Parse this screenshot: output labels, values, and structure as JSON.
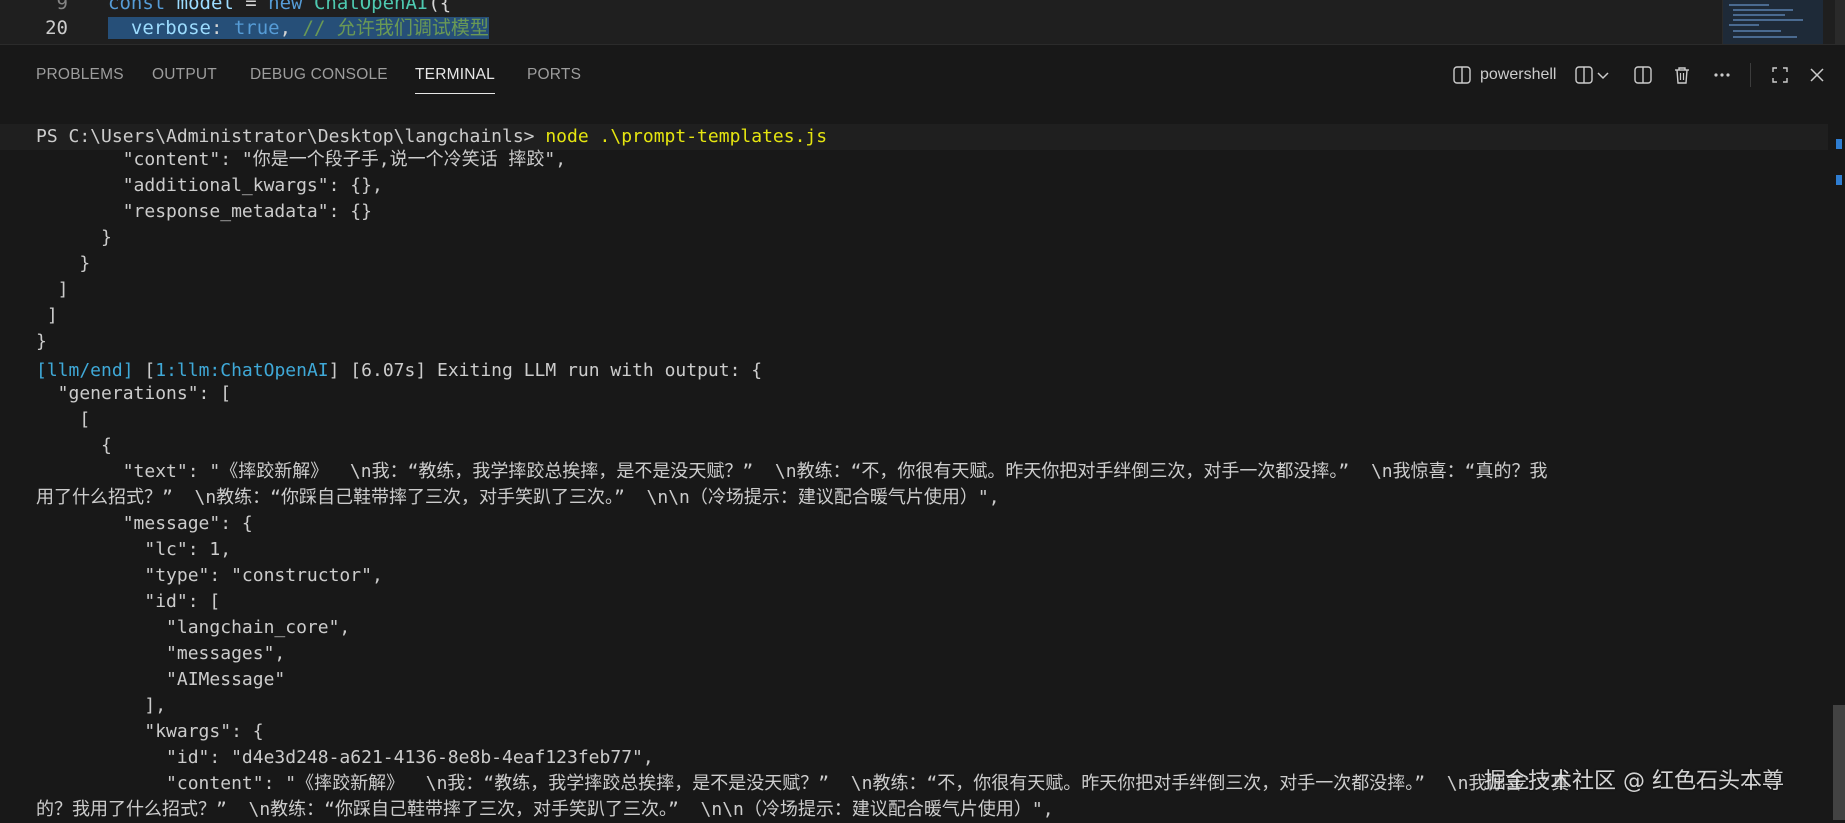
{
  "editor": {
    "lines": [
      {
        "number": "9",
        "parts": [
          {
            "cls": "kw",
            "text": "const "
          },
          {
            "cls": "prop",
            "text": "model"
          },
          {
            "cls": "plain",
            "text": " = "
          },
          {
            "cls": "kw",
            "text": "new "
          },
          {
            "cls": "fn",
            "text": "ChatOpenAI"
          },
          {
            "cls": "plain",
            "text": "({"
          }
        ]
      },
      {
        "number": "20",
        "parts": [
          {
            "cls": "prop",
            "text": "  verbose"
          },
          {
            "cls": "plain",
            "text": ": "
          },
          {
            "cls": "kw",
            "text": "true"
          },
          {
            "cls": "plain",
            "text": ", "
          },
          {
            "cls": "cmt",
            "text": "// 允许我们调试模型"
          }
        ]
      }
    ]
  },
  "panel": {
    "tabs": [
      "PROBLEMS",
      "OUTPUT",
      "DEBUG CONSOLE",
      "TERMINAL",
      "PORTS"
    ],
    "active_tab": "TERMINAL",
    "terminal_name": "powershell"
  },
  "terminal": {
    "prompt": "PS C:\\Users\\Administrator\\Desktop\\langchainls> ",
    "command": "node .\\prompt-templates.js",
    "lines": [
      "        \"content\": \"你是一个段子手,说一个冷笑话 摔跤\",",
      "        \"additional_kwargs\": {},",
      "        \"response_metadata\": {}",
      "      }",
      "    }",
      "  ]",
      " ]",
      "}",
      "",
      "  \"generations\": [",
      "    [",
      "      {",
      "        \"text\": \"《摔跤新解》  \\n我：“教练，我学摔跤总挨摔，是不是没天赋？”  \\n教练：“不，你很有天赋。昨天你把对手绊倒三次，对手一次都没摔。”  \\n我惊喜：“真的？我",
      "用了什么招式？”  \\n教练：“你踩自己鞋带摔了三次，对手笑趴了三次。”  \\n\\n（冷场提示：建议配合暖气片使用）\",",
      "        \"message\": {",
      "          \"lc\": 1,",
      "          \"type\": \"constructor\",",
      "          \"id\": [",
      "            \"langchain_core\",",
      "            \"messages\",",
      "            \"AIMessage\"",
      "          ],",
      "          \"kwargs\": {",
      "            \"id\": \"d4e3d248-a621-4136-8e8b-4eaf123feb77\",",
      "            \"content\": \"《摔跤新解》  \\n我：“教练，我学摔跤总挨摔，是不是没天赋？”  \\n教练：“不，你很有天赋。昨天你把对手绊倒三次，对手一次都没摔。”  \\n我惊喜：“真",
      "的？我用了什么招式？”  \\n教练：“你踩自己鞋带摔了三次，对手笑趴了三次。”  \\n\\n（冷场提示：建议配合暖气片使用）\","
    ],
    "llm_end": {
      "tag": "[llm/end]",
      "run": "[1:llm:ChatOpenAI]",
      "rest": " [6.07s] Exiting LLM run with output: {"
    }
  },
  "watermark": "掘金技术社区 @ 红色石头本尊"
}
